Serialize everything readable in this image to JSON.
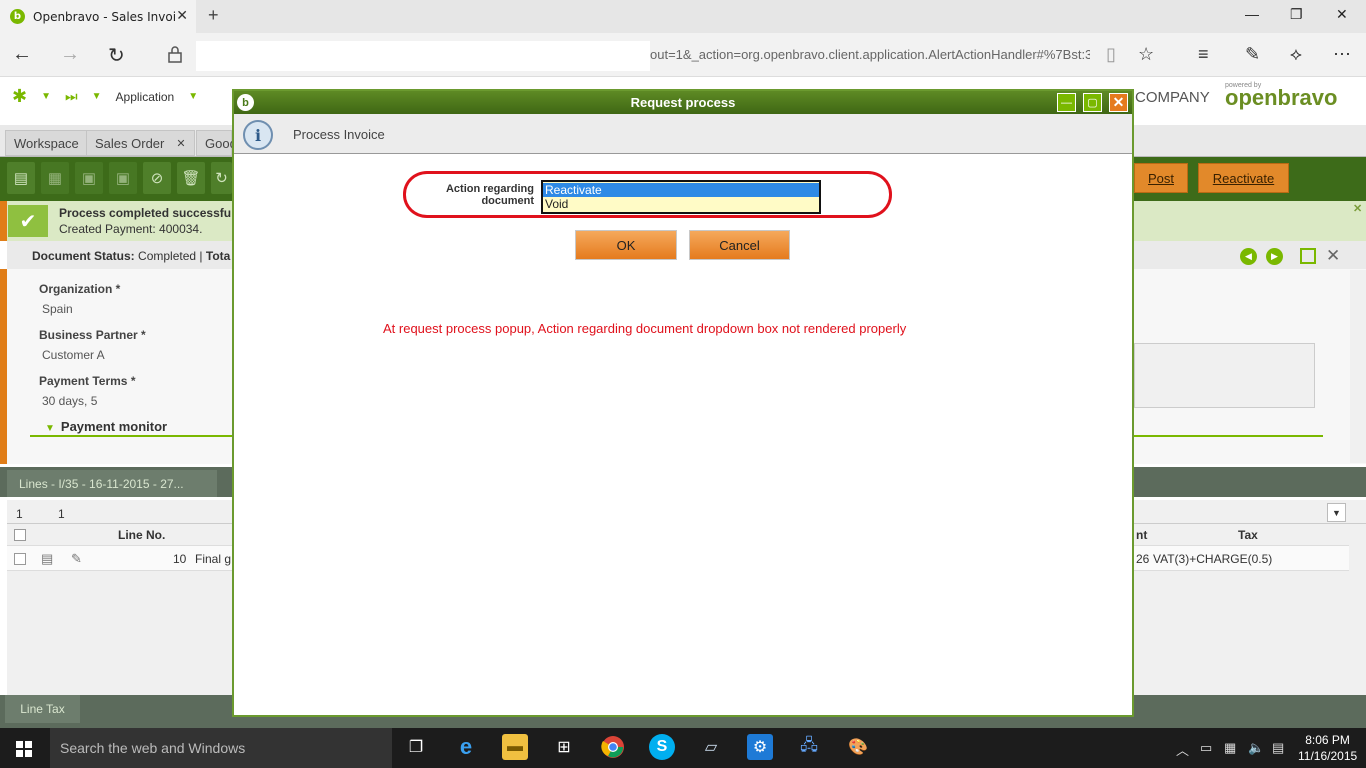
{
  "browser": {
    "tab_title": "Openbravo - Sales Invoi",
    "url_text": "out=1&_action=org.openbravo.client.application.AlertActionHandler#%7Bst:3"
  },
  "app": {
    "menu_application": "Application",
    "company": "COMPANY",
    "logo_powered": "powered by",
    "logo_text": "openbravo",
    "tabs": [
      "Workspace",
      "Sales Order",
      "Good"
    ],
    "buttons": {
      "post": "Post",
      "reactivate": "Reactivate"
    },
    "message_title": "Process completed successfu",
    "message_detail": "Created Payment: 400034.",
    "status_label": "Document Status:",
    "status_value": "Completed",
    "status_sep": "|",
    "status_total": "Tota",
    "fields": {
      "org_label": "Organization *",
      "org_value": "Spain",
      "bp_label": "Business Partner *",
      "bp_value": "Customer A",
      "pt_label": "Payment Terms *",
      "pt_value": "30 days, 5"
    },
    "payment_monitor": "Payment monitor",
    "lines_tab": "Lines - I/35 - 16-11-2015 - 27...",
    "grid": {
      "count1": "1",
      "count2": "1",
      "col_line_no": "Line No.",
      "col_nt": "nt",
      "col_tax": "Tax",
      "row_line_no": "10",
      "row_desc": "Final g",
      "row_amount": "26",
      "row_tax": "VAT(3)+CHARGE(0.5)"
    },
    "line_tax_tab": "Line Tax"
  },
  "dialog": {
    "title": "Request process",
    "header": "Process Invoice",
    "action_label_1": "Action regarding",
    "action_label_2": "document",
    "options": [
      "Reactivate",
      "Void"
    ],
    "selected": "Reactivate",
    "ok": "OK",
    "cancel": "Cancel",
    "annotation": "At request process popup, Action regarding document dropdown box not rendered properly"
  },
  "taskbar": {
    "search_placeholder": "Search the web and Windows",
    "time": "8:06 PM",
    "date": "11/16/2015"
  },
  "colors": {
    "accent_green": "#7ab800",
    "dialog_title": "#4f7a1c",
    "button_orange": "#e57b1e",
    "annotation_red": "#e0111c",
    "selection_blue": "#2e8ae6"
  }
}
